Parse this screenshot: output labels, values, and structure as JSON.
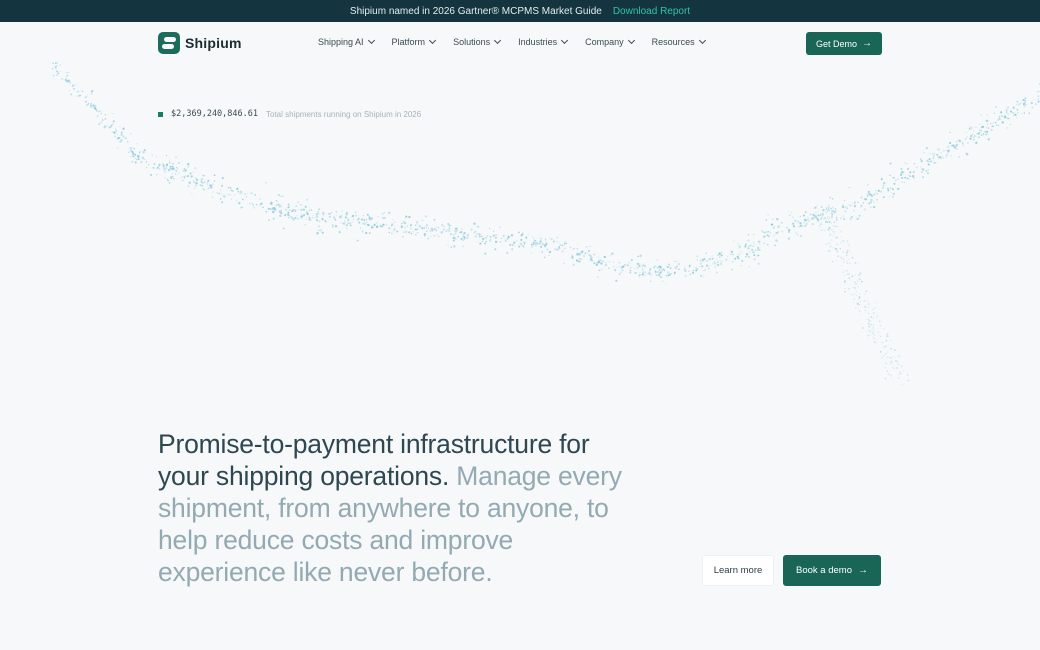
{
  "announcement": {
    "text": "Shipium named in 2026 Gartner® MCPMS Market Guide",
    "link": "Download Report"
  },
  "brand": {
    "name": "Shipium"
  },
  "nav": {
    "items": [
      {
        "label": "Shipping AI"
      },
      {
        "label": "Platform"
      },
      {
        "label": "Solutions"
      },
      {
        "label": "Industries"
      },
      {
        "label": "Company"
      },
      {
        "label": "Resources"
      }
    ],
    "cta": "Get Demo"
  },
  "counter": {
    "value": "$2,369,240,846.61",
    "caption": "Total shipments running on Shipium in 2026"
  },
  "hero": {
    "headline_dark": "Promise-to-payment infrastructure for your shipping operations.",
    "headline_light": "Manage every shipment, from anywhere to anyone, to help reduce costs and improve experience like never before."
  },
  "actions": {
    "learn_more": "Learn more",
    "book_demo": "Book a demo"
  },
  "colors": {
    "accent": "#1a6656",
    "banner": "#14353f",
    "link": "#2fc3a6",
    "particles": "#7ec4d6"
  }
}
